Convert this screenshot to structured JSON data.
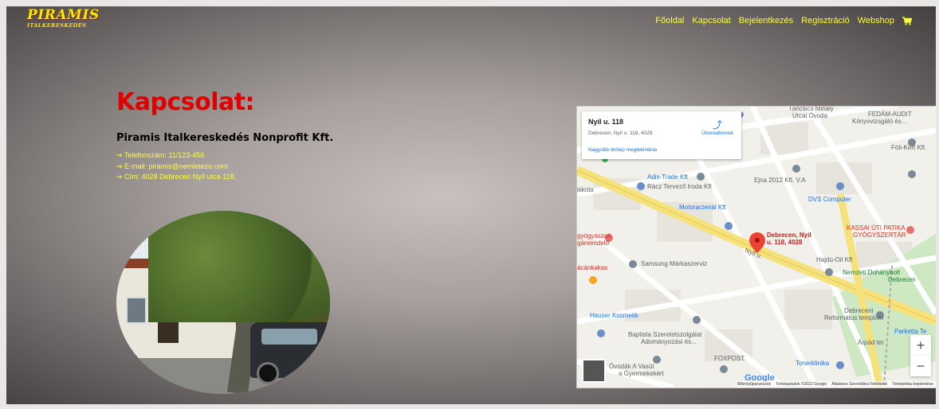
{
  "brand": {
    "line1": "PIRAMIS",
    "line2": "ITALKERESKEDÉS"
  },
  "nav": {
    "items": [
      "Főoldal",
      "Kapcsolat",
      "Bejelentkezés",
      "Regisztráció",
      "Webshop"
    ],
    "cart_icon": "cart-icon"
  },
  "contact": {
    "title": "Kapcsolat:",
    "company": "Piramis Italkereskedés Nonprofit Kft.",
    "lines": [
      "⇒ Telefonszám: 11/123-456",
      "⇒ E-mail: piramis@nemletezo.com",
      "⇒ Cím: 4028 Debrecen Nyíl utca 118."
    ]
  },
  "map": {
    "card_title": "Nyíl u. 118",
    "card_address": "Debrecen, Nyíl u. 118, 4028",
    "card_link": "Nagyobb térkép megtekintése",
    "directions": "Útvonaltervek",
    "pin_label_1": "Debrecen, Nyíl",
    "pin_label_2": "u. 118, 4028",
    "labels": [
      "Táncsics Mihály",
      "Utcai Óvoda",
      "FEDÁM-AUDIT",
      "Könyvvizsgáló és...",
      "Fóli-Kert Kft",
      "Adix-Trade Kft",
      "Rácz Tervező Iroda Kft",
      "Ejna 2012 Kft. V.A",
      "DVS Computer",
      "Motorarzenál Kft",
      "KASSAI ÚTI PATIKA",
      "GYÓGYSZERTÁR",
      "Samsung Márkaszerviz",
      "Hajdú-Oil Kft",
      "Nemzeti Dohánybolt",
      "Debrecen",
      "Hauser Kosmetik",
      "Baptista Szeretetszolgálat",
      "Adományozási és...",
      "Debreceni",
      "Református templom",
      "FOXPOST",
      "Tonerklinika",
      "Óvodák A Vasút",
      "a Gyermekekért",
      "Parketta Te",
      "Árpád tér",
      "iskola",
      "gyógyászati",
      "gánrendelő",
      "ácánkakas",
      "Nyíl u."
    ],
    "zoom_in": "+",
    "zoom_out": "−",
    "google": "Google",
    "attribution": [
      "Billentyűparancsok",
      "Térképadatok ©2022 Google",
      "Általános Szerződési Feltételek",
      "Térképhiba bejelentése"
    ]
  }
}
